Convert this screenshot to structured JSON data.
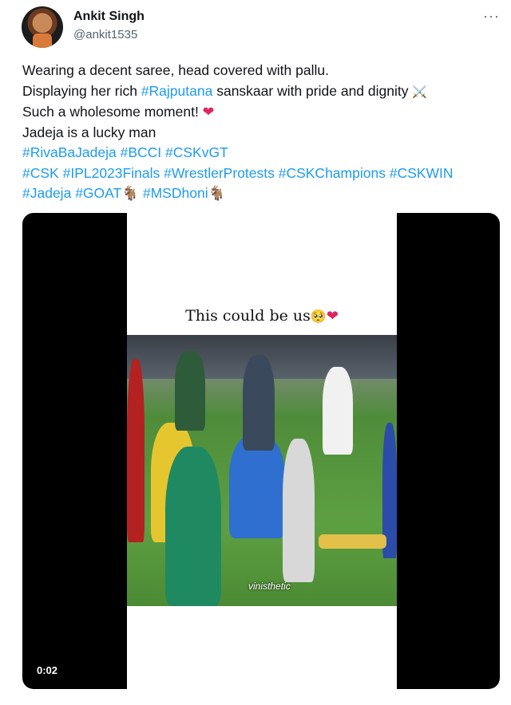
{
  "author": {
    "name": "Ankit Singh",
    "handle": "@ankit1535"
  },
  "menu": {
    "more_label": "···"
  },
  "tweet": {
    "line1": "Wearing a decent saree, head covered with pallu.",
    "line2_pre": "Displaying her rich ",
    "line2_tag": "#Rajputana",
    "line2_post": " sanskaar with pride and dignity ",
    "line2_emoji": "⚔️",
    "line3": "Such a wholesome moment! ",
    "line3_emoji": "❤",
    "line4": "Jadeja is a lucky man",
    "tags_row1": [
      "#RivaBaJadeja",
      "#BCCI",
      "#CSKvGT"
    ],
    "tags_row2": [
      "#CSK",
      "#IPL2023Finals",
      "#WrestlerProtests",
      "#CSKChampions",
      "#CSKWIN"
    ],
    "tags_row3": [
      "#Jadeja",
      "#GOAT🐐",
      "#MSDhoni🐐"
    ]
  },
  "video": {
    "caption": "This could be us",
    "caption_emoji_face": "🥺",
    "caption_emoji_heart": "❤",
    "watermark": "vinisthetic",
    "timestamp": "0:02"
  },
  "colors": {
    "link": "#1d9bf0",
    "text": "#0f1419",
    "muted": "#536471"
  }
}
